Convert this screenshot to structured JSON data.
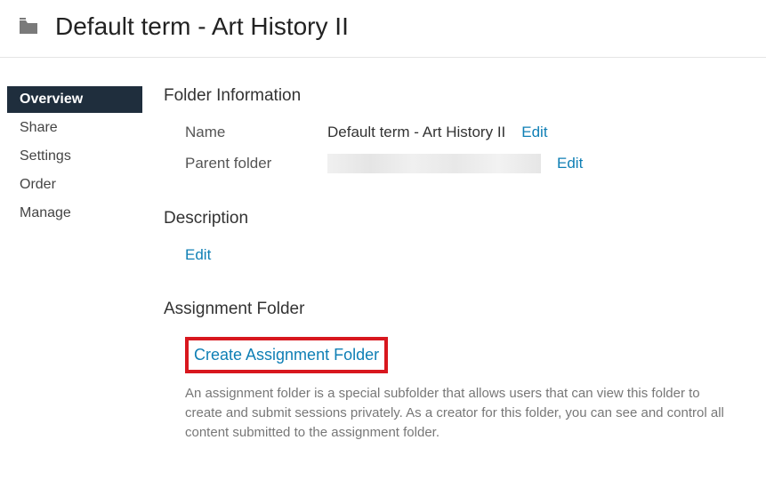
{
  "header": {
    "title": "Default term - Art History II"
  },
  "sidebar": {
    "items": [
      {
        "label": "Overview",
        "active": true
      },
      {
        "label": "Share",
        "active": false
      },
      {
        "label": "Settings",
        "active": false
      },
      {
        "label": "Order",
        "active": false
      },
      {
        "label": "Manage",
        "active": false
      }
    ]
  },
  "folder_info": {
    "heading": "Folder Information",
    "name_label": "Name",
    "name_value": "Default term - Art History II",
    "name_edit": "Edit",
    "parent_label": "Parent folder",
    "parent_edit": "Edit"
  },
  "description": {
    "heading": "Description",
    "edit": "Edit"
  },
  "assignment": {
    "heading": "Assignment Folder",
    "create_link": "Create Assignment Folder",
    "help_text": "An assignment folder is a special subfolder that allows users that can view this folder to create and submit sessions privately. As a creator for this folder, you can see and control all content submitted to the assignment folder."
  }
}
